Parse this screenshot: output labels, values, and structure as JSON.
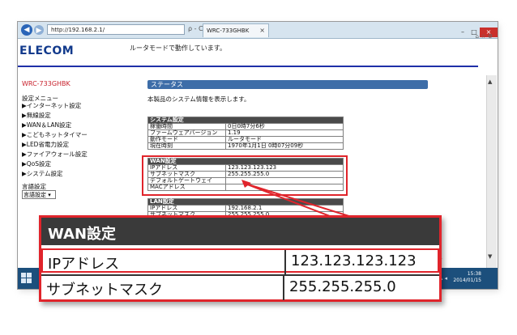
{
  "browser": {
    "address": "http://192.168.2.1/",
    "address_tools": "ρ - C",
    "tab_title": "WRC-733GHBK",
    "tab_close": "×",
    "win_min": "–",
    "win_max": "□",
    "win_close": "×",
    "toolbar_icons": "⌂ ☆ ⚙"
  },
  "header": {
    "logo": "ELECOM",
    "router_message": "ルータモードで動作しています。"
  },
  "sidebar": {
    "model": "WRC-733GHBK",
    "menu_heading": "設定メニュー",
    "items": [
      "▶インターネット設定",
      "▶無線設定",
      "▶WAN＆LAN設定",
      "▶こどもネットタイマー",
      "▶LED省電力設定",
      "▶ファイアウォール設定",
      "▶QoS設定",
      "▶システム設定"
    ],
    "language_label": "言語設定",
    "language_value": "言語設定 ▾"
  },
  "main": {
    "title": "ステータス",
    "description": "本製品のシステム情報を表示します。",
    "system": {
      "heading": "システム設定",
      "rows": [
        [
          "稼働時間",
          "0日0時7分6秒"
        ],
        [
          "ファームウェアバージョン",
          "1.19"
        ],
        [
          "動作モード",
          "ルータモード"
        ],
        [
          "現在時刻",
          "1970年1月1日 0時07分09秒"
        ]
      ]
    },
    "wan": {
      "heading": "WAN設定",
      "rows": [
        [
          "IPアドレス",
          "123.123.123.123"
        ],
        [
          "サブネットマスク",
          "255.255.255.0"
        ],
        [
          "デフォルトゲートウェイ",
          ""
        ],
        [
          "MACアドレス",
          ""
        ]
      ]
    },
    "lan": {
      "heading": "LAN設定",
      "rows": [
        [
          "IPアドレス",
          "192.168.2.1"
        ],
        [
          "サブネットマスク",
          "255.255.255.0"
        ]
      ]
    }
  },
  "taskbar": {
    "tray": "▴ ◂",
    "time": "15:38",
    "date": "2014/01/15"
  },
  "zoom": {
    "heading": "WAN設定",
    "row1_key": "IPアドレス",
    "row1_value": "123.123.123.123",
    "row2_key": "サブネットマスク",
    "row2_value": "255.255.255.0"
  },
  "colors": {
    "highlight": "#e0242b",
    "brand": "#123a8c",
    "status_bar": "#3d6da8"
  }
}
